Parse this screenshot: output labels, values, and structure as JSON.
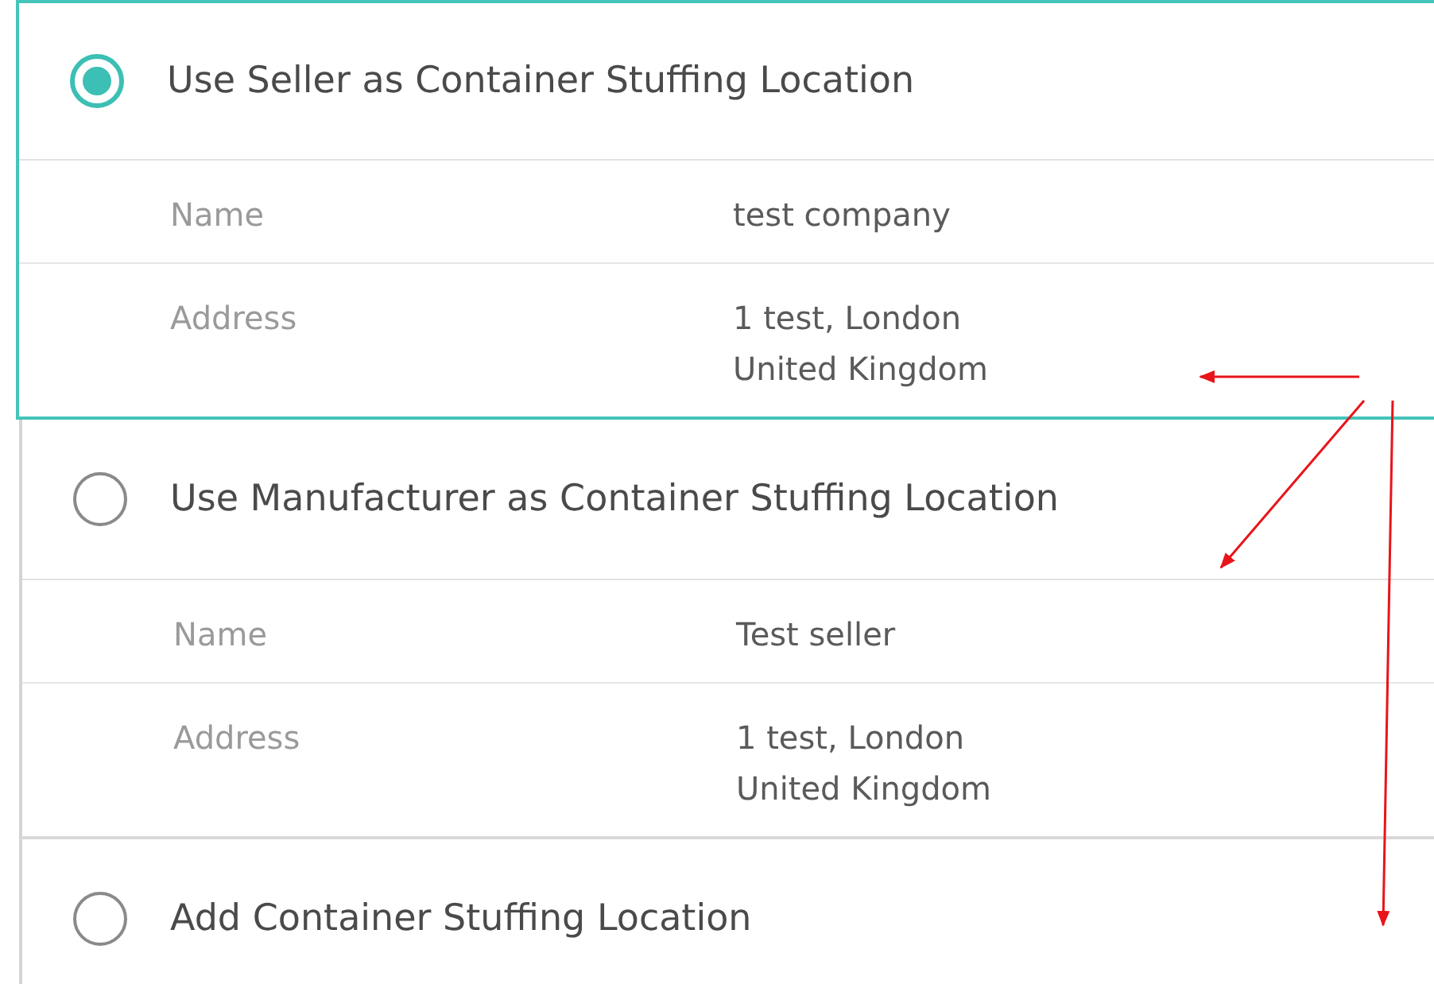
{
  "options": [
    {
      "title": "Use Seller as Container Stuffing Location",
      "selected": true,
      "details": [
        {
          "label": "Name",
          "value": [
            "test company"
          ]
        },
        {
          "label": "Address",
          "value": [
            "1 test, London",
            "United Kingdom"
          ]
        }
      ]
    },
    {
      "title": "Use Manufacturer as Container Stuffing Location",
      "selected": false,
      "details": [
        {
          "label": "Name",
          "value": [
            "Test seller"
          ]
        },
        {
          "label": "Address",
          "value": [
            "1 test, London",
            "United Kingdom"
          ]
        }
      ]
    },
    {
      "title": "Add Container Stuffing Location",
      "selected": false
    }
  ]
}
